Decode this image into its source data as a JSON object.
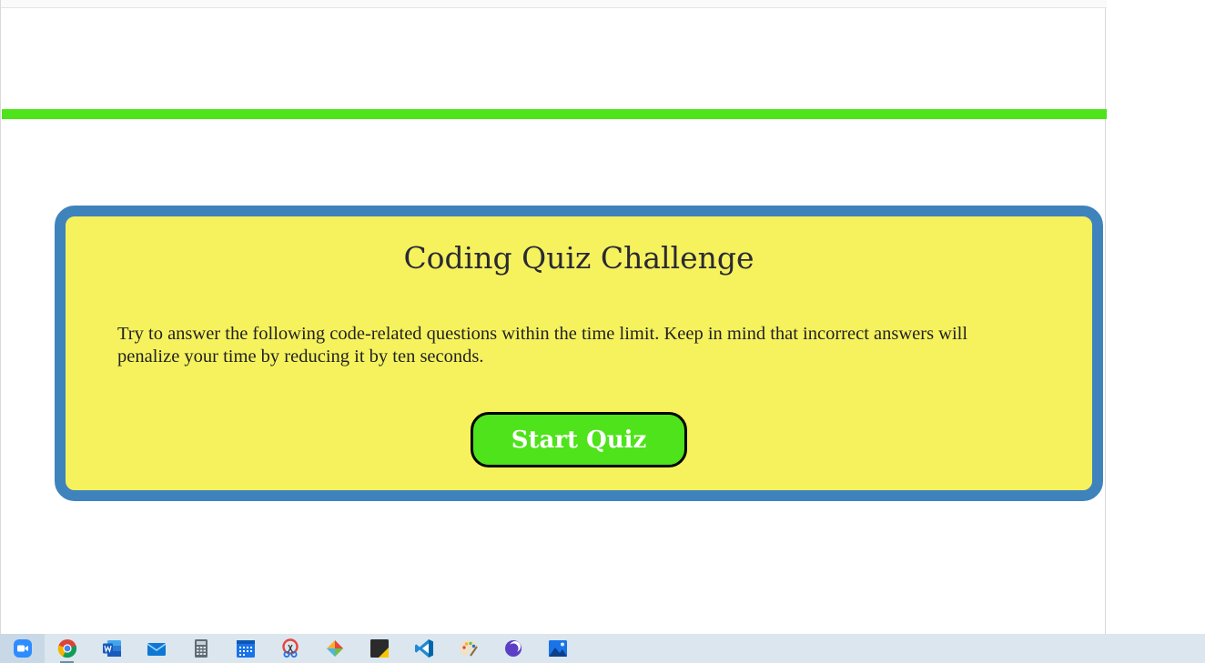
{
  "quiz": {
    "title": "Coding Quiz Challenge",
    "description": "Try to answer the following code-related questions within the time limit. Keep in mind that incorrect answers will penalize your time by reducing it by ten seconds.",
    "start_label": "Start Quiz"
  },
  "colors": {
    "accent_bar": "#4ee31a",
    "card_border": "#3f83bd",
    "card_background": "#f6f25e",
    "button_background": "#4ee31a"
  },
  "taskbar": {
    "apps": [
      {
        "name": "zoom-icon"
      },
      {
        "name": "chrome-icon"
      },
      {
        "name": "word-icon"
      },
      {
        "name": "mail-icon"
      },
      {
        "name": "calculator-icon"
      },
      {
        "name": "calendar-icon"
      },
      {
        "name": "snipping-tool-icon"
      },
      {
        "name": "git-tool-icon"
      },
      {
        "name": "sticky-notes-icon"
      },
      {
        "name": "vscode-icon"
      },
      {
        "name": "paint-icon"
      },
      {
        "name": "media-player-icon"
      },
      {
        "name": "photos-icon"
      }
    ]
  }
}
